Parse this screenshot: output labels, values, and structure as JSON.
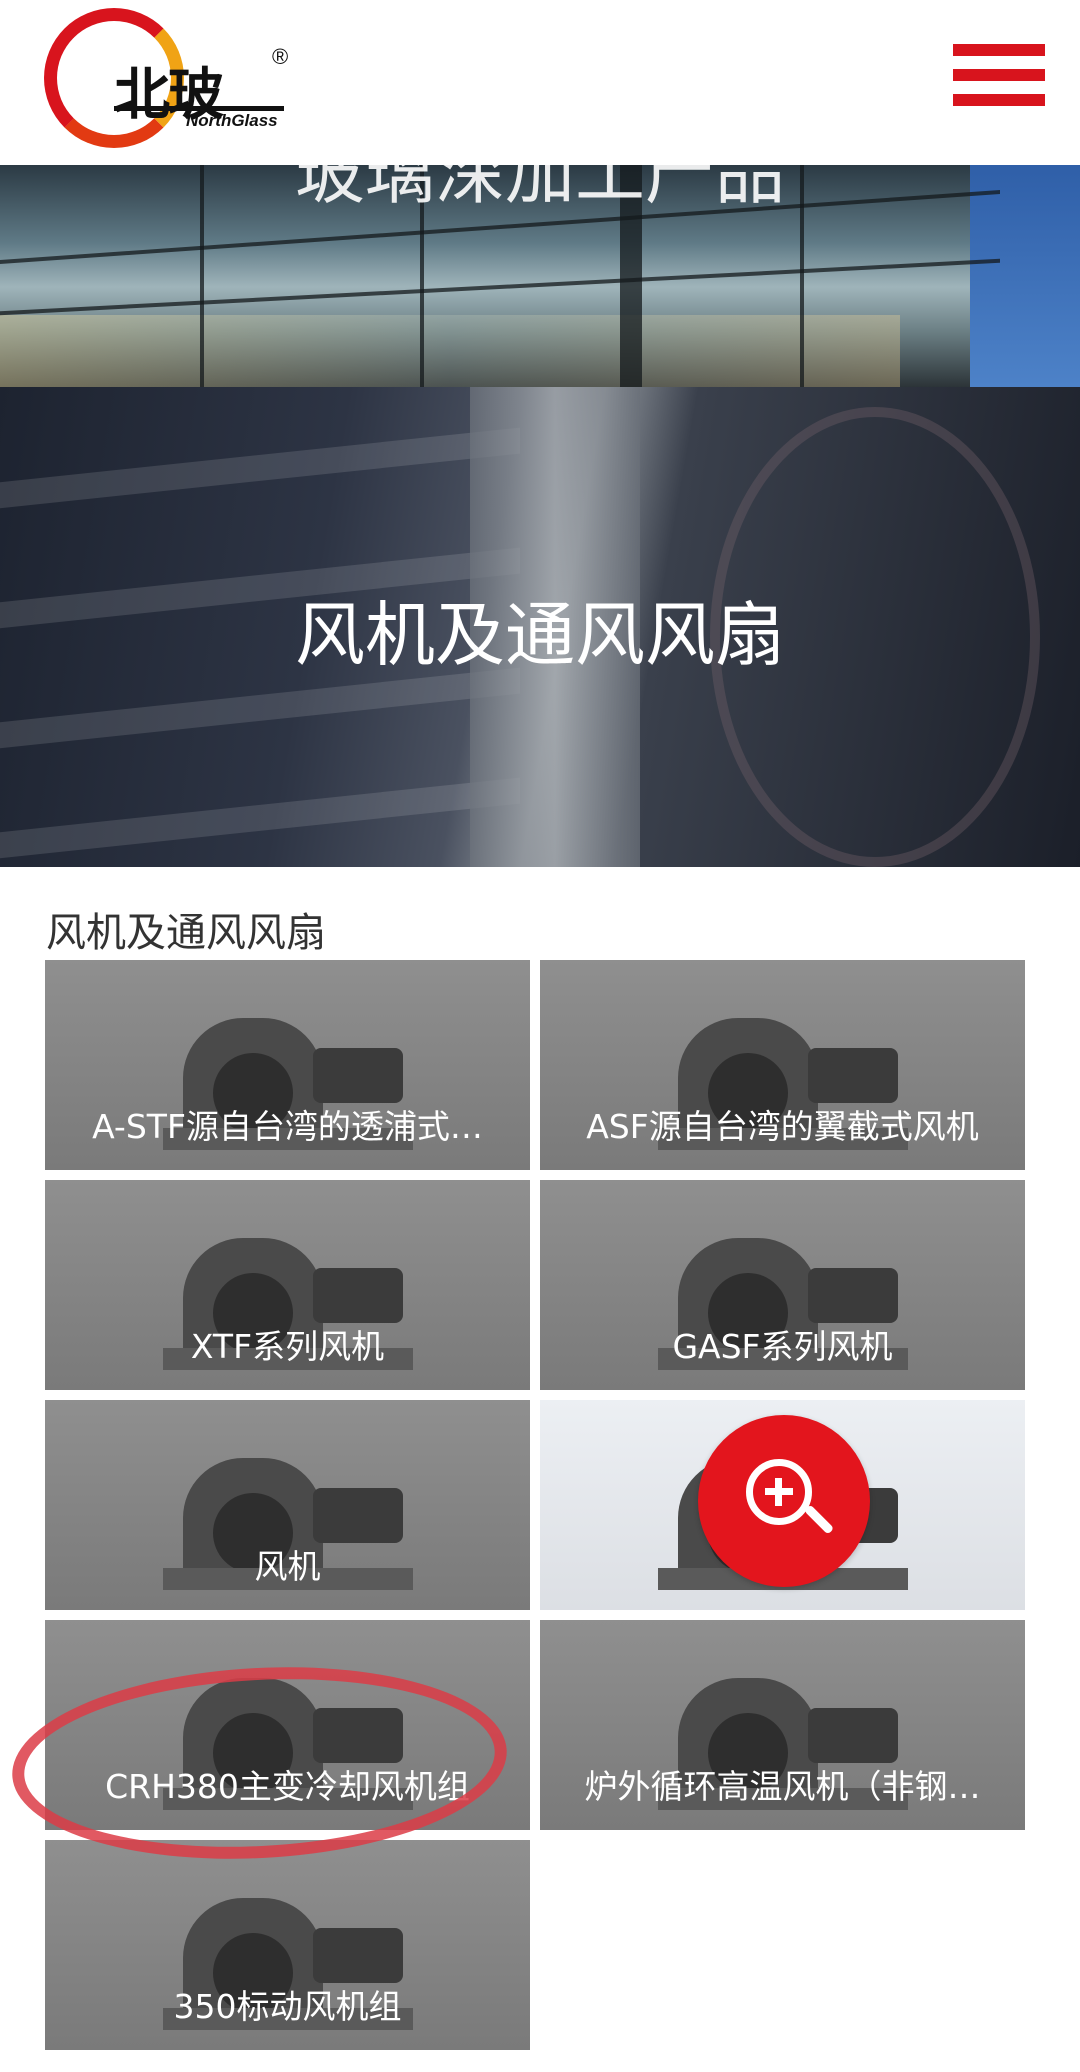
{
  "header": {
    "logo_text": "北玻",
    "logo_sub": "NorthGlass",
    "logo_reg": "®"
  },
  "banners": {
    "glass_title": "玻璃深加工产品",
    "fan_title": "风机及通风风扇"
  },
  "section": {
    "title": "风机及通风风扇",
    "items": [
      {
        "label": "A-STF源自台湾的透浦式…"
      },
      {
        "label": "ASF源自台湾的翼截式风机"
      },
      {
        "label": "XTF系列风机"
      },
      {
        "label": "GASF系列风机"
      },
      {
        "label": "风机"
      },
      {
        "label": ""
      },
      {
        "label": "CRH380主变冷却风机组"
      },
      {
        "label": "炉外循环高温风机（非钢…"
      },
      {
        "label": "350标动风机组"
      }
    ]
  },
  "colors": {
    "brand_red": "#d8141d",
    "brand_orange": "#f0a315",
    "annotation": "#dc3c46"
  },
  "icons": {
    "menu": "hamburger-icon",
    "zoom": "zoom-in-icon"
  }
}
